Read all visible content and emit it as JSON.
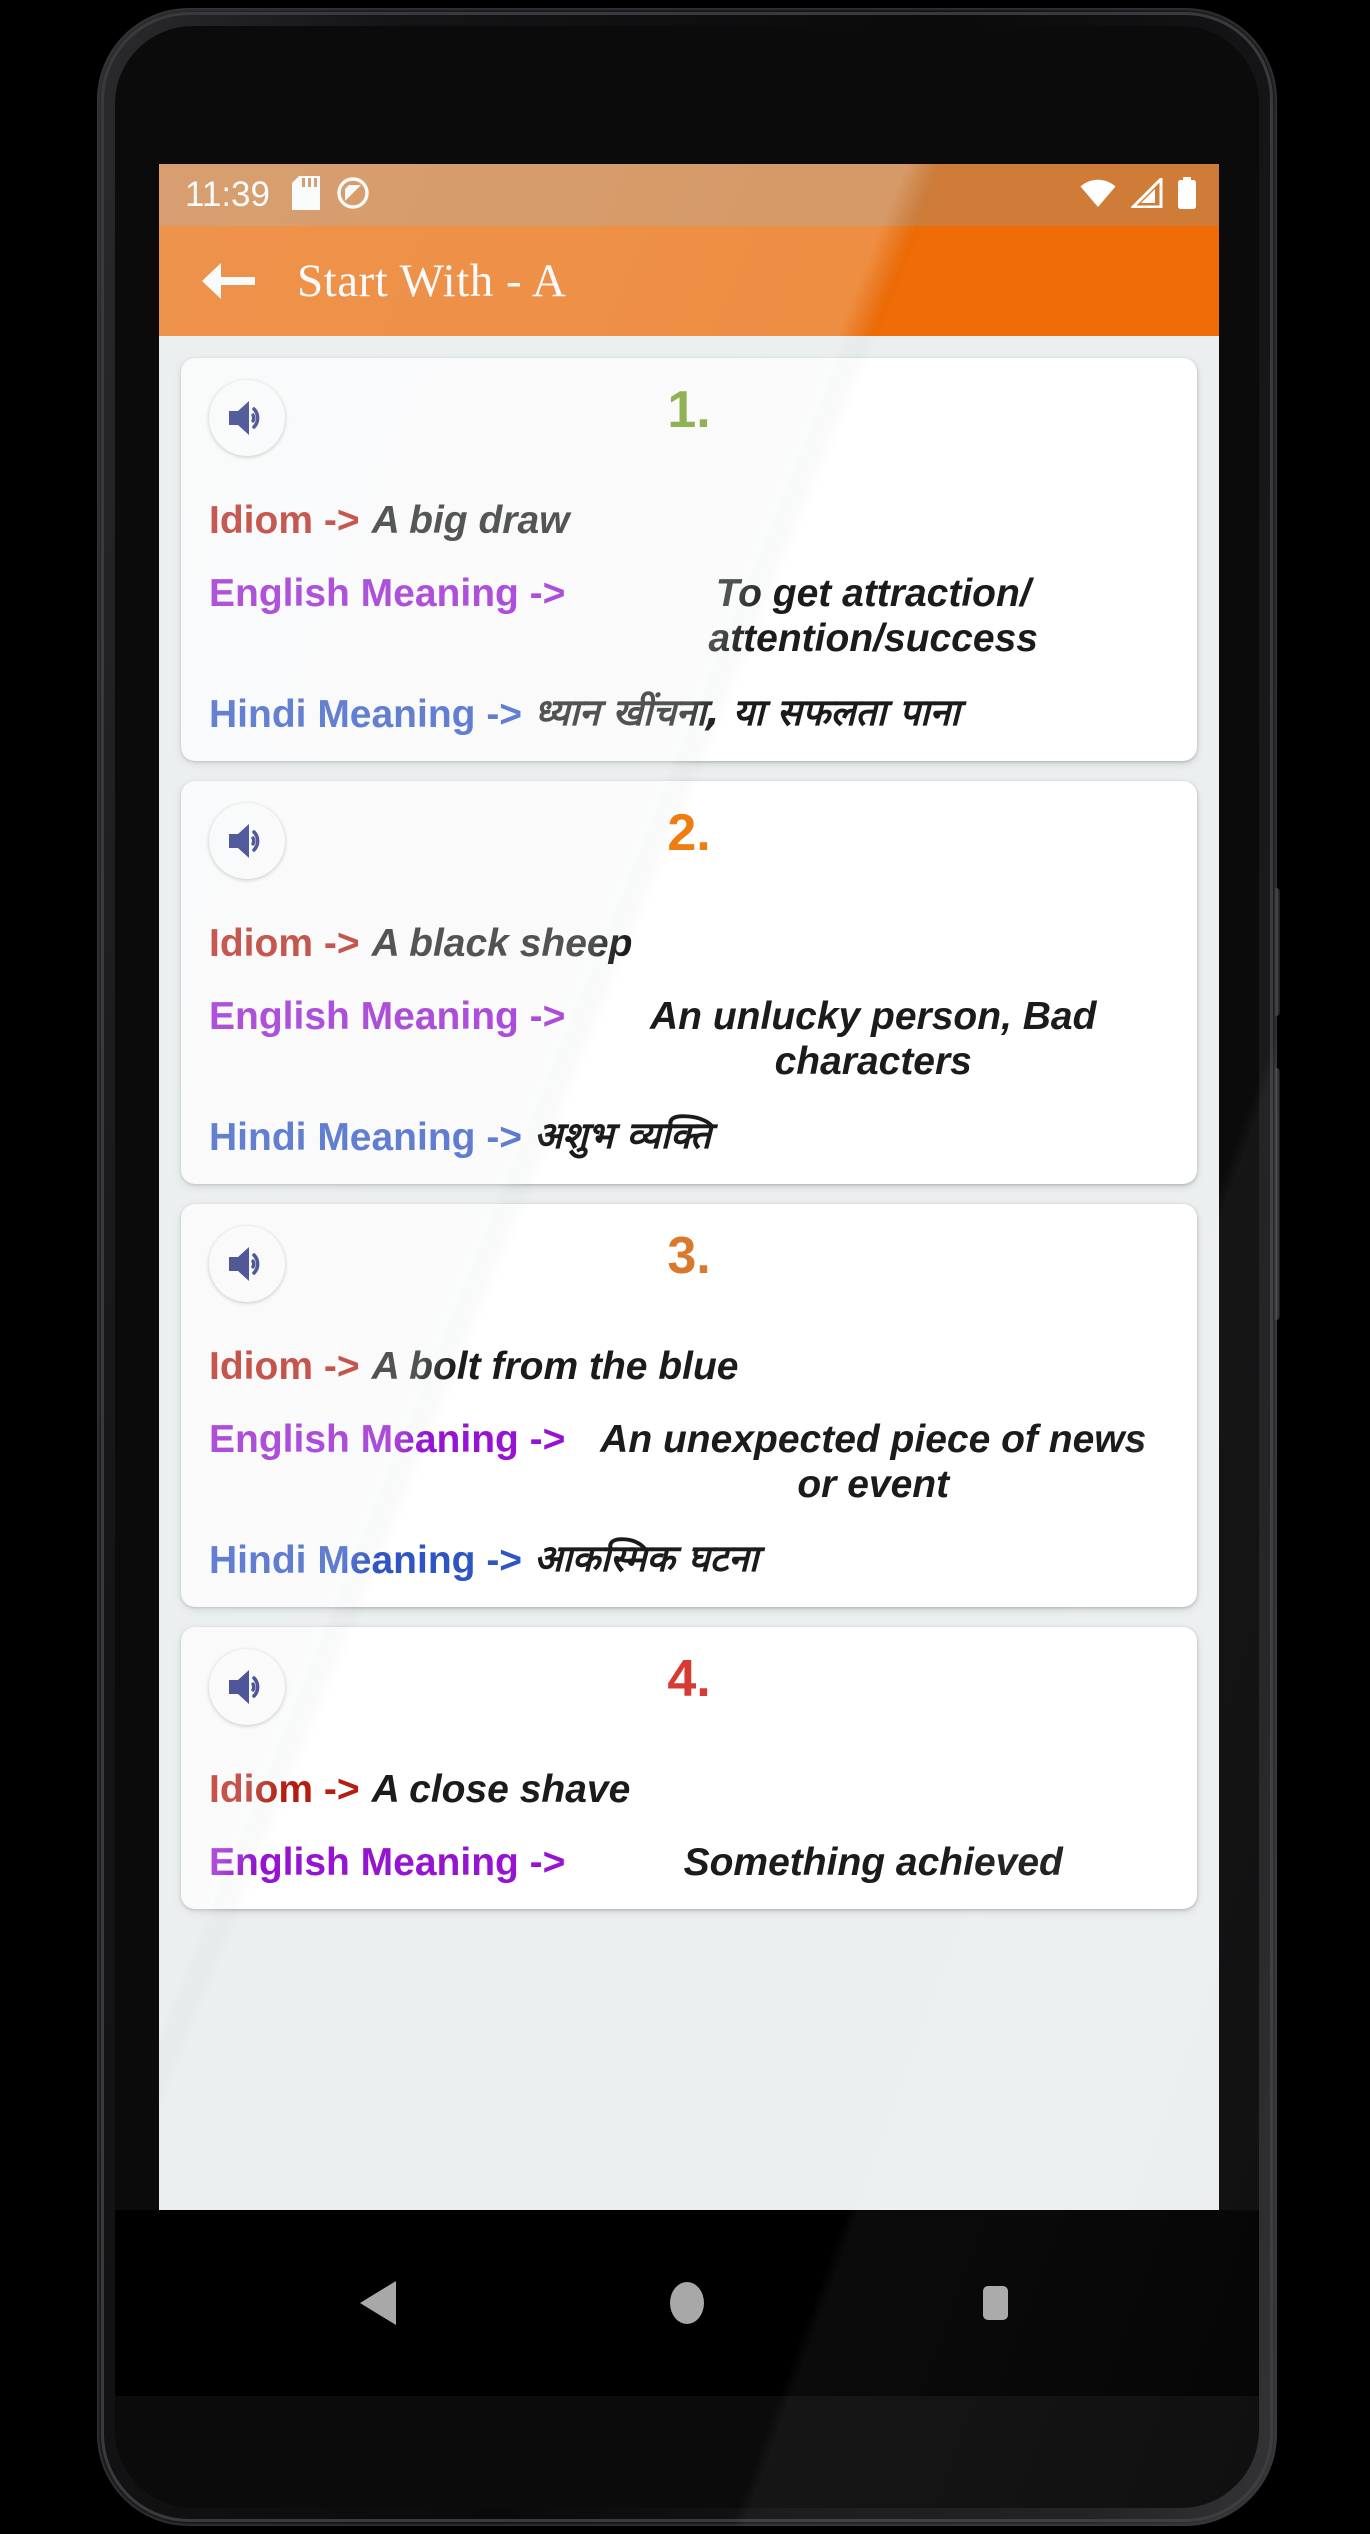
{
  "status_bar": {
    "clock": "11:39",
    "left_icons": [
      "sd-card-icon",
      "do-not-disturb-icon"
    ],
    "right_icons": [
      "wifi-icon",
      "cell-signal-icon",
      "battery-icon"
    ],
    "background_color": "#cf7c38"
  },
  "app_bar": {
    "back_label": "back-arrow-icon",
    "title": "Start With - A",
    "background_color": "#ef6c06"
  },
  "labels": {
    "idiom": "Idiom ->",
    "english": "English Meaning ->",
    "hindi": "Hindi Meaning ->"
  },
  "cards": [
    {
      "index": "1.",
      "index_color": "#6f9c1b",
      "speaker_icon": "speaker-icon",
      "idiom": "A big draw",
      "english": "To get attraction/ attention/success",
      "hindi": "ध्यान खींचना, या सफलता पाना"
    },
    {
      "index": "2.",
      "index_color": "#f07d10",
      "speaker_icon": "speaker-icon",
      "idiom": "A black sheep",
      "english": "An unlucky person, Bad characters",
      "hindi": "अशुभ व्यक्ति"
    },
    {
      "index": "3.",
      "index_color": "#d9792b",
      "speaker_icon": "speaker-icon",
      "idiom": "A bolt from the blue",
      "english": "An unexpected piece of news or event",
      "hindi": "आकस्मिक घटना"
    },
    {
      "index": "4.",
      "index_color": "#d63a33",
      "speaker_icon": "speaker-icon",
      "idiom": "A close shave",
      "english": "Something achieved",
      "hindi": ""
    }
  ],
  "nav_bar": {
    "back": "nav-back-icon",
    "home": "nav-home-icon",
    "recents": "nav-recents-icon"
  },
  "theme": {
    "label_idiom_color": "#b61d11",
    "label_english_color": "#9614d1",
    "label_hindi_color": "#2f55c4",
    "value_color": "#1b1b1b",
    "screen_background": "#eceff0",
    "card_background": "#ffffff"
  }
}
